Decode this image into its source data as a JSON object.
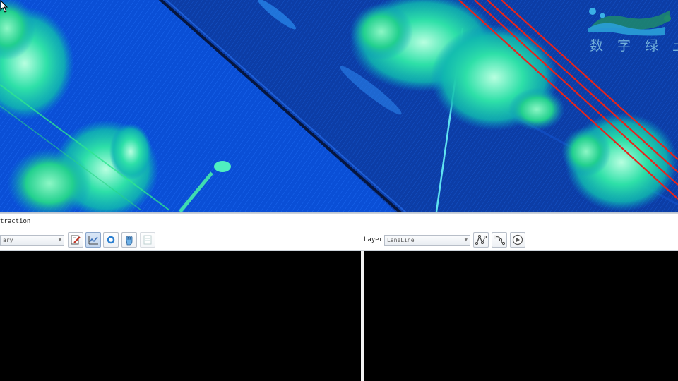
{
  "viewport": {
    "name": "Point cloud view",
    "colors": {
      "road": "#0a4fd6",
      "road_dark": "#0b2f7a",
      "vegetation": "#1ed6a0",
      "vegetation_light": "#7ff0c8",
      "lane_line": "#e8231b"
    }
  },
  "watermark": {
    "text": "数 字 绿 土",
    "icon": "company-logo"
  },
  "panel": {
    "title": "traction",
    "left_combo": {
      "value": "ary"
    },
    "left_tools": [
      {
        "icon": "edit-document-icon"
      },
      {
        "icon": "line-chart-icon"
      },
      {
        "icon": "circle-point-icon"
      },
      {
        "icon": "hand-pick-icon"
      },
      {
        "icon": "notes-icon"
      }
    ],
    "layer_label": "Layer:",
    "layer_combo": {
      "value": "LaneLine"
    },
    "right_tools": [
      {
        "icon": "polyline-vertex-icon"
      },
      {
        "icon": "curve-nodes-icon"
      },
      {
        "icon": "play-icon"
      }
    ]
  }
}
